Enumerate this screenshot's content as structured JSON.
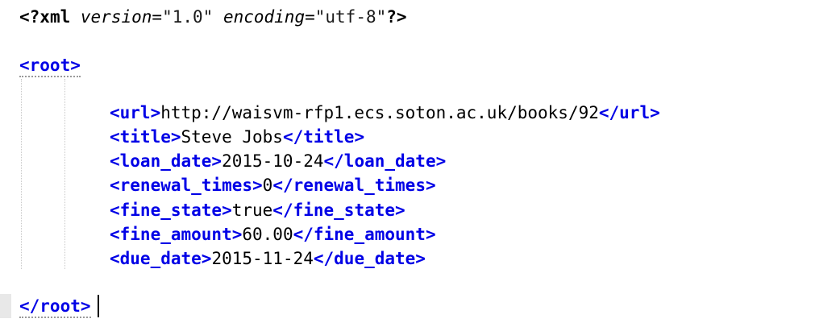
{
  "declaration": {
    "open": "<?",
    "name": "xml",
    "attr1_name": "version",
    "attr1_eq": "=",
    "attr1_value": "\"1.0\"",
    "attr2_name": "encoding",
    "attr2_eq": "=",
    "attr2_value": "\"utf-8\"",
    "close": "?>"
  },
  "root_open": "<root>",
  "root_close_tag": "</root",
  "root_close_gt": ">",
  "elements": [
    {
      "open": "<url>",
      "value": "http://waisvm-rfp1.ecs.soton.ac.uk/books/92",
      "close": "</url>"
    },
    {
      "open": "<title>",
      "value": "Steve Jobs",
      "close": "</title>"
    },
    {
      "open": "<loan_date>",
      "value": "2015-10-24",
      "close": "</loan_date>"
    },
    {
      "open": "<renewal_times>",
      "value": "0",
      "close": "</renewal_times>"
    },
    {
      "open": "<fine_state>",
      "value": "true",
      "close": "</fine_state>"
    },
    {
      "open": "<fine_amount>",
      "value": "60.00",
      "close": "</fine_amount>"
    },
    {
      "open": "<due_date>",
      "value": "2015-11-24",
      "close": "</due_date>"
    }
  ]
}
